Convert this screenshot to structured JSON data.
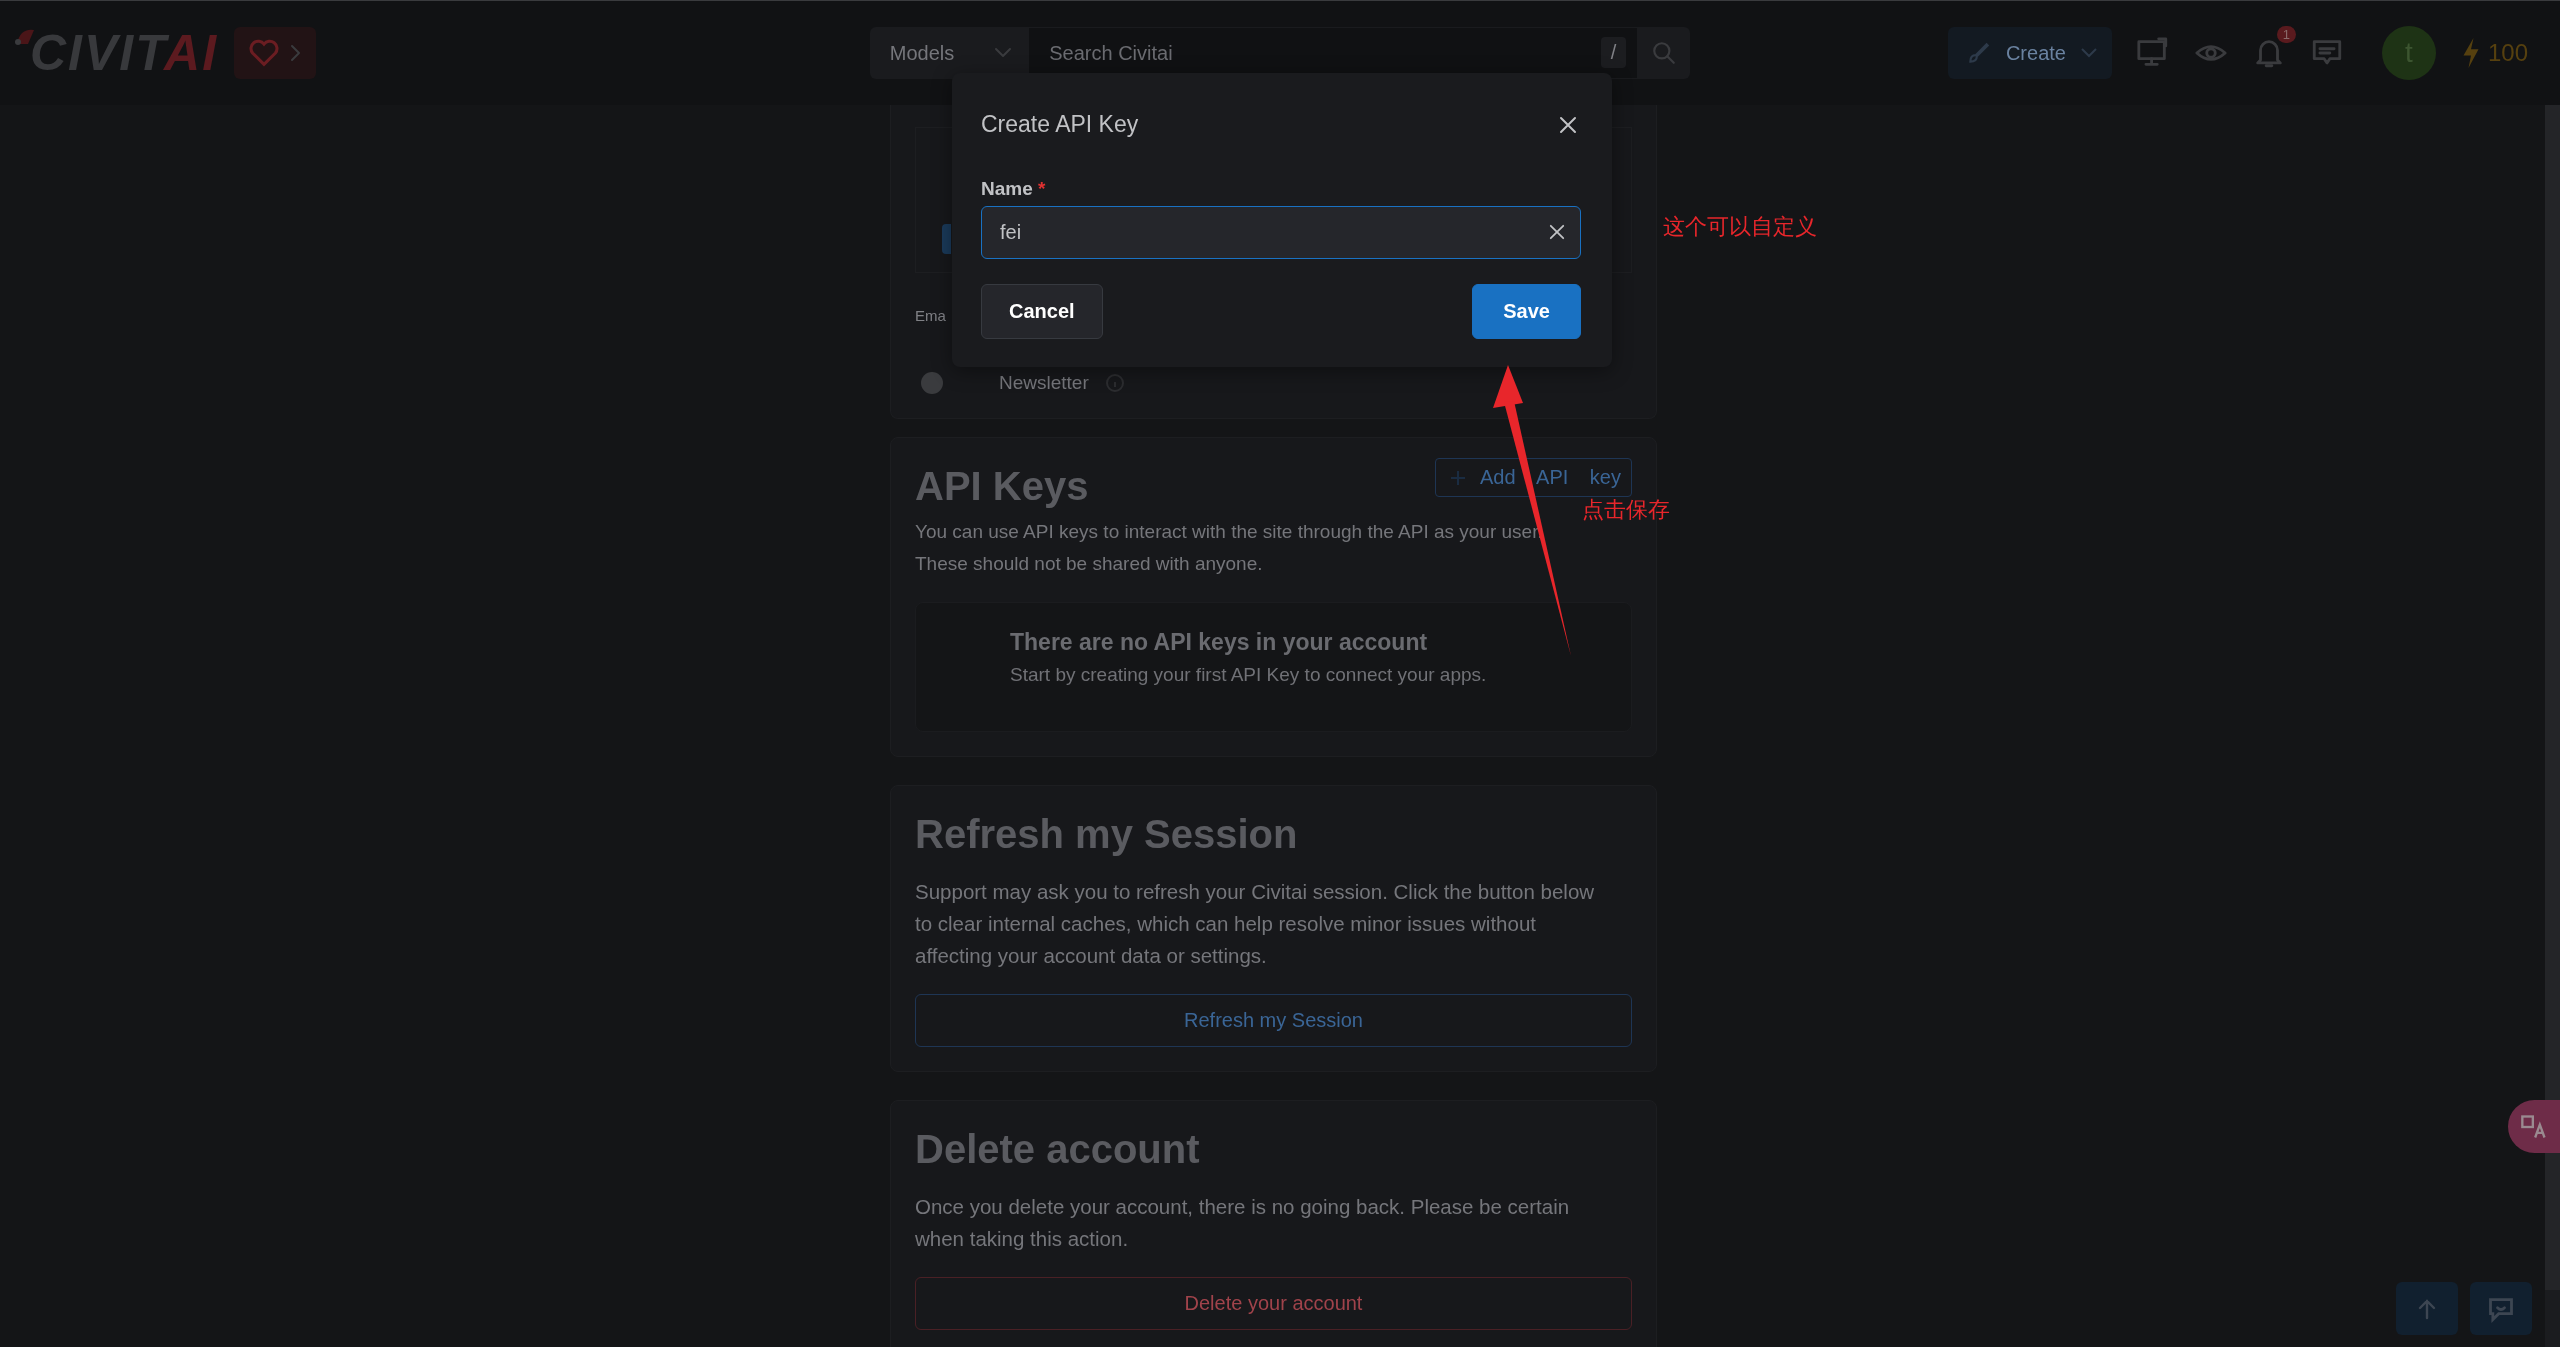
{
  "header": {
    "logo": {
      "main": "CIVIT",
      "accent": "AI"
    },
    "search": {
      "category": "Models",
      "placeholder": "Search Civitai",
      "shortcut": "/"
    },
    "create_button": "Create",
    "notification_badge": "1",
    "avatar_initial": "t",
    "buzz": "100"
  },
  "account_card": {
    "email_label": "Ema",
    "newsletter": {
      "label": "Newsletter",
      "on": false
    }
  },
  "api_keys": {
    "title": "API Keys",
    "add_button": "Add API key",
    "description": [
      "You can use API keys to interact with the site through the API as your user.",
      "These should not be shared with anyone."
    ],
    "empty_title": "There are no API keys in your account",
    "empty_text": "Start by creating your first API Key to connect your apps."
  },
  "refresh_session": {
    "title": "Refresh my Session",
    "description": "Support may ask you to refresh your Civitai session. Click the button below to clear internal caches, which can help resolve minor issues without affecting your account data or settings.",
    "button": "Refresh my Session"
  },
  "delete_account": {
    "title": "Delete account",
    "description": "Once you delete your account, there is no going back. Please be certain when taking this action.",
    "button": "Delete your account"
  },
  "modal": {
    "title": "Create API Key",
    "field": {
      "label": "Name",
      "required_mark": "*",
      "value": "fei"
    },
    "buttons": [
      {
        "label": "Cancel",
        "kind": "secondary"
      },
      {
        "label": "Save",
        "kind": "primary"
      }
    ]
  },
  "annotations": [
    {
      "text": "这个可以自定义"
    },
    {
      "text": "点击保存"
    }
  ]
}
